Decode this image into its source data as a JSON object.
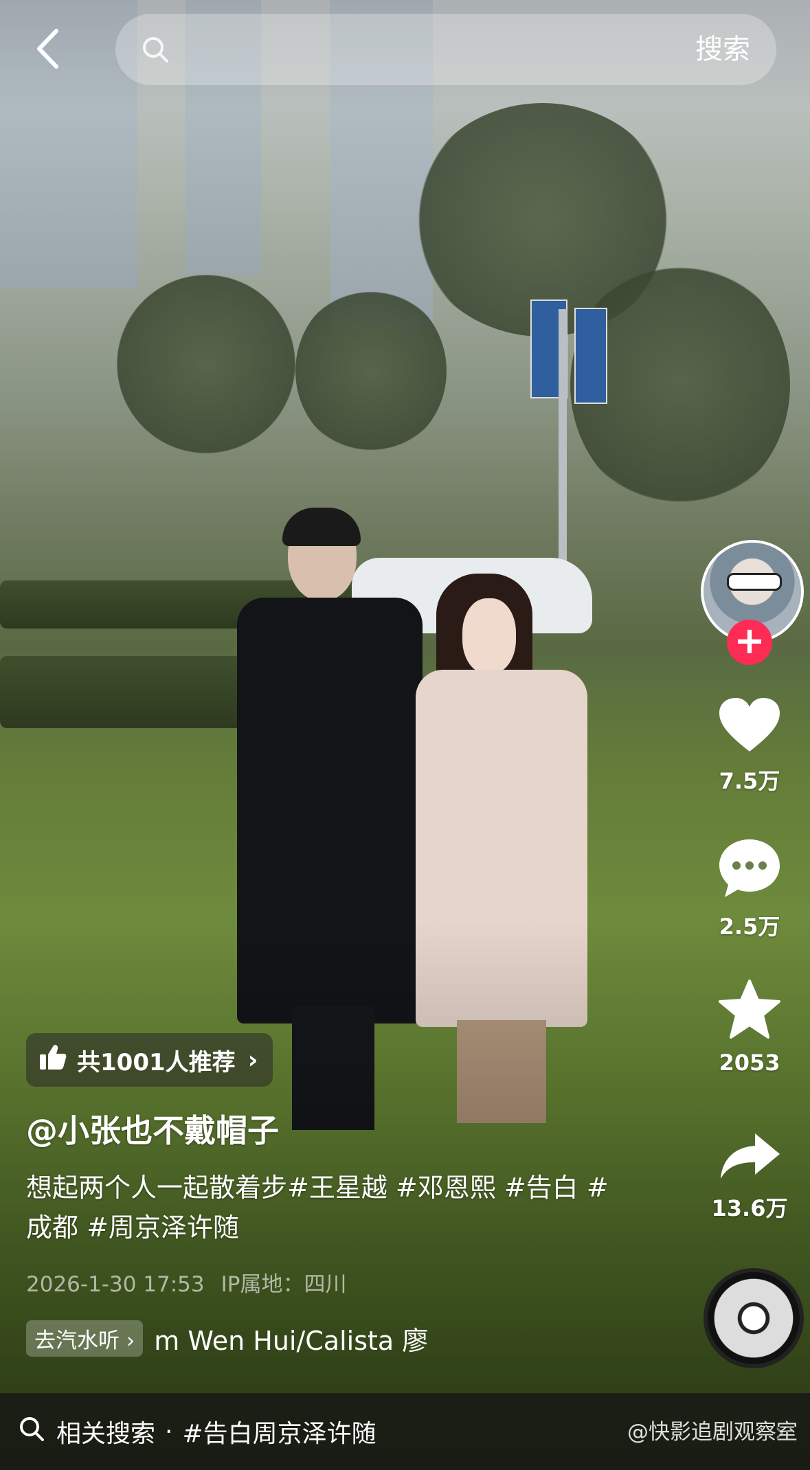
{
  "search": {
    "placeholder": "",
    "submit_label": "搜索"
  },
  "actions": {
    "likes": "7.5万",
    "comments": "2.5万",
    "favorites": "2053",
    "shares": "13.6万"
  },
  "colors": {
    "follow_accent": "#fe2c55"
  },
  "icons": [
    "back-icon",
    "search-icon",
    "heart-icon",
    "comment-icon",
    "star-icon",
    "share-icon",
    "thumbs-up-icon",
    "chevron-right-icon"
  ],
  "recommend": {
    "label": "共1001人推荐"
  },
  "author": {
    "handle": "@小张也不戴帽子"
  },
  "caption": {
    "text": "想起两个人一起散着步#王星越 #邓恩熙 #告白 #成都 #周京泽许随"
  },
  "meta": {
    "date": "2026-1-30 17:53",
    "ip": "IP属地：四川"
  },
  "music": {
    "button": "去汽水听 ›",
    "title": "m Wen Hui/Calista 廖"
  },
  "related": {
    "prefix": "相关搜索",
    "dot": "·",
    "query": "#告白周京泽许随"
  },
  "watermark": {
    "text": "@快影追剧观察室"
  }
}
